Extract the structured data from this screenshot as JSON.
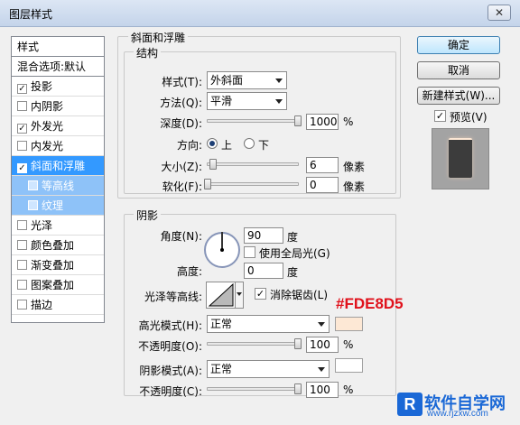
{
  "window": {
    "title": "图层样式"
  },
  "style_list": {
    "header": "样式",
    "blend_options": "混合选项:默认",
    "items": [
      {
        "label": "投影",
        "checked": true
      },
      {
        "label": "内阴影",
        "checked": false
      },
      {
        "label": "外发光",
        "checked": true
      },
      {
        "label": "内发光",
        "checked": false
      },
      {
        "label": "斜面和浮雕",
        "checked": true,
        "active": true
      },
      {
        "label": "等高线",
        "checked": false,
        "sub": true
      },
      {
        "label": "纹理",
        "checked": false,
        "sub": true
      },
      {
        "label": "光泽",
        "checked": false
      },
      {
        "label": "颜色叠加",
        "checked": false
      },
      {
        "label": "渐变叠加",
        "checked": false
      },
      {
        "label": "图案叠加",
        "checked": false
      },
      {
        "label": "描边",
        "checked": false
      }
    ]
  },
  "bevel": {
    "title": "斜面和浮雕",
    "structure_title": "结构",
    "style_label": "样式(T):",
    "style_value": "外斜面",
    "method_label": "方法(Q):",
    "method_value": "平滑",
    "depth_label": "深度(D):",
    "depth_value": "1000",
    "depth_unit": "%",
    "direction_label": "方向:",
    "dir_up": "上",
    "dir_down": "下",
    "size_label": "大小(Z):",
    "size_value": "6",
    "size_unit": "像素",
    "soften_label": "软化(F):",
    "soften_value": "0",
    "soften_unit": "像素"
  },
  "shading": {
    "title": "阴影",
    "angle_label": "角度(N):",
    "angle_value": "90",
    "angle_unit": "度",
    "global_light_label": "使用全局光(G)",
    "altitude_label": "高度:",
    "altitude_value": "0",
    "altitude_unit": "度",
    "gloss_label": "光泽等高线:",
    "antialias_label": "消除锯齿(L)",
    "highlight_label": "高光模式(H):",
    "highlight_value": "正常",
    "highlight_color": "#FDE8D5",
    "opacity1_label": "不透明度(O):",
    "opacity1_value": "100",
    "opacity1_unit": "%",
    "shadow_label": "阴影模式(A):",
    "shadow_value": "正常",
    "shadow_color": "#FFFFFF",
    "opacity2_label": "不透明度(C):",
    "opacity2_value": "100",
    "opacity2_unit": "%"
  },
  "buttons": {
    "ok": "确定",
    "cancel": "取消",
    "new_style": "新建样式(W)...",
    "preview": "预览(V)"
  },
  "annotation": "#FDE8D5",
  "watermark": {
    "logo": "R",
    "text": "软件自学网",
    "url": "www.rjzxw.com"
  },
  "sliders": {
    "depth": 1.0,
    "size": 0.06,
    "soften": 0.0,
    "opacity1": 1.0,
    "opacity2": 1.0
  }
}
